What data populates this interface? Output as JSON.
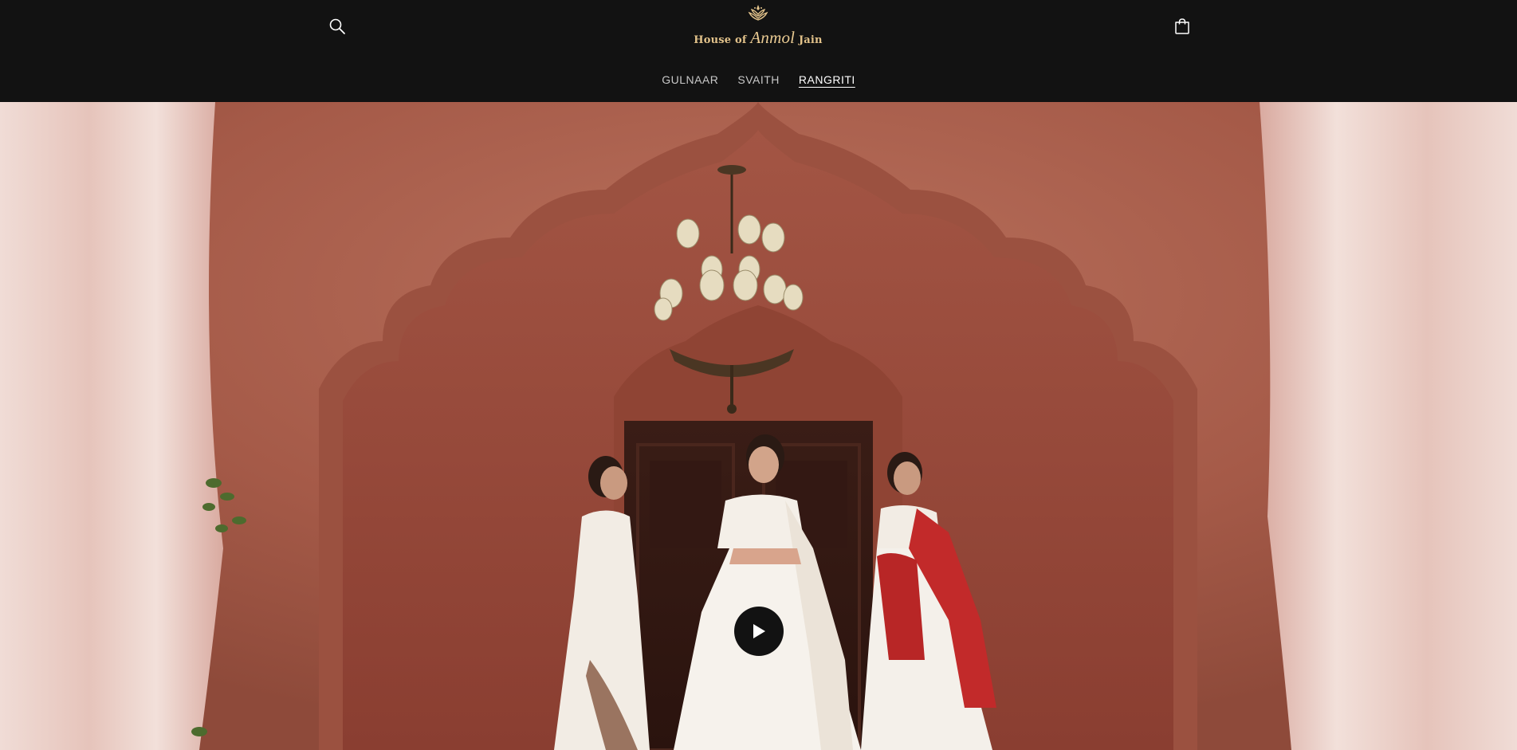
{
  "brand": {
    "name_part1": "House of ",
    "name_highlight": "Anmol",
    "name_part2": " Jain",
    "color": "#e2c28a"
  },
  "header": {
    "search_icon": "search-icon",
    "cart_icon": "cart-icon"
  },
  "nav": {
    "items": [
      {
        "label": "GULNAAR",
        "active": false
      },
      {
        "label": "SVAITH",
        "active": false
      },
      {
        "label": "RANGRITI",
        "active": true
      }
    ]
  },
  "hero": {
    "type": "video",
    "play_icon": "play-icon",
    "wall_color": "#a55a48",
    "curtain_color": "#e8c8bf"
  },
  "colors": {
    "header_bg": "#121212",
    "nav_text": "#c8c8c8",
    "nav_active": "#ffffff"
  }
}
